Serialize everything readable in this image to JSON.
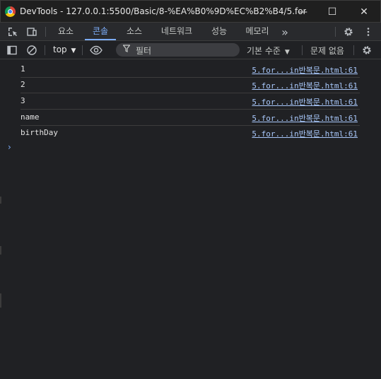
{
  "window": {
    "title": "DevTools - 127.0.0.1:5500/Basic/8-%EA%B0%9D%EC%B2%B4/5.for.....",
    "minimize_glyph": "—",
    "maximize_glyph": "☐",
    "close_glyph": "✕"
  },
  "tabs": [
    {
      "label": "요소"
    },
    {
      "label": "콘솔"
    },
    {
      "label": "소스"
    },
    {
      "label": "네트워크"
    },
    {
      "label": "성능"
    },
    {
      "label": "메모리"
    }
  ],
  "active_tab": "콘솔",
  "more_tabs_glyph": "»",
  "console_toolbar": {
    "context": "top",
    "filter_placeholder": "필터",
    "levels": "기본 수준",
    "issues": "문제 없음"
  },
  "logs": [
    {
      "message": "1",
      "source": "5.for...in반복문.html:61"
    },
    {
      "message": "2",
      "source": "5.for...in반복문.html:61"
    },
    {
      "message": "3",
      "source": "5.for...in반복문.html:61"
    },
    {
      "message": "name",
      "source": "5.for...in반복문.html:61"
    },
    {
      "message": "birthDay",
      "source": "5.for...in반복문.html:61"
    }
  ],
  "prompt_glyph": "›",
  "icons": [
    "chrome-logo-icon",
    "inspect-element-icon",
    "device-toolbar-icon",
    "gear-icon",
    "kebab-menu-icon",
    "sidebar-toggle-icon",
    "clear-console-icon",
    "dropdown-arrow-icon",
    "eye-icon",
    "filter-icon"
  ]
}
